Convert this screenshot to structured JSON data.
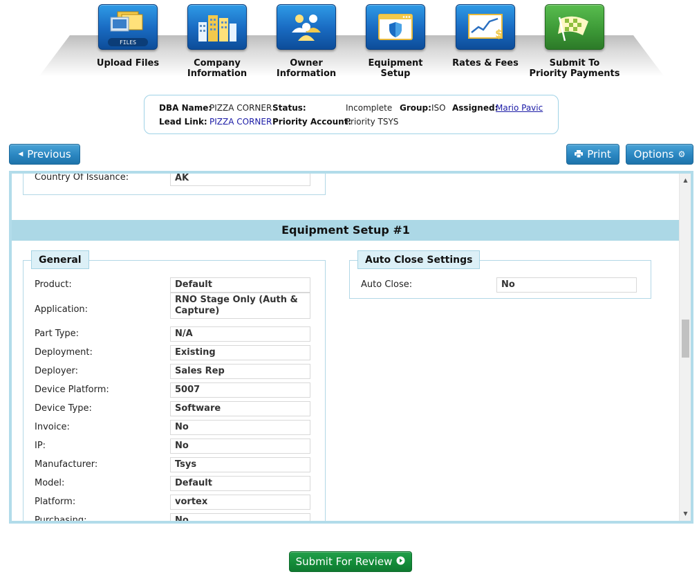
{
  "nav": {
    "steps": [
      {
        "label": "Upload Files",
        "icon": "upload-files-icon",
        "icon_text": "FILES"
      },
      {
        "label": "Company Information",
        "line1": "Company",
        "line2": "Information",
        "icon": "company-buildings-icon"
      },
      {
        "label": "Owner Information",
        "line1": "Owner",
        "line2": "Information",
        "icon": "owners-people-icon"
      },
      {
        "label": "Equipment Setup",
        "line1": "Equipment",
        "line2": "Setup",
        "icon": "equipment-window-shield-icon"
      },
      {
        "label": "Rates & Fees",
        "icon": "rates-chart-icon"
      },
      {
        "label": "Submit To Priority Payments",
        "line1": "Submit To",
        "line2": "Priority Payments",
        "icon": "checkered-flag-icon"
      }
    ]
  },
  "info": {
    "dba_label": "DBA Name:",
    "dba_value": "PIZZA CORNER",
    "status_label": "Status:",
    "status_value": "Incomplete",
    "group_label": "Group:",
    "group_value": "ISO",
    "assigned_label": "Assigned:",
    "assigned_value": "Mario Pavic",
    "lead_label": "Lead Link:",
    "lead_value": "PIZZA CORNER",
    "account_label": "Priority Account:",
    "account_value": "Priority TSYS"
  },
  "toolbar": {
    "previous_label": "Previous",
    "print_label": "Print",
    "options_label": "Options"
  },
  "prev_section": {
    "country_label": "Country Of Issuance:",
    "country_value": "AK"
  },
  "equipment": {
    "title": "Equipment Setup #1",
    "general": {
      "legend": "General",
      "fields": [
        {
          "label": "Product:",
          "value": "Default"
        },
        {
          "label": "Application:",
          "value": "RNO Stage Only (Auth & Capture)"
        },
        {
          "label": "Part Type:",
          "value": "N/A"
        },
        {
          "label": "Deployment:",
          "value": "Existing"
        },
        {
          "label": "Deployer:",
          "value": "Sales Rep"
        },
        {
          "label": "Device Platform:",
          "value": "5007"
        },
        {
          "label": "Device Type:",
          "value": "Software"
        },
        {
          "label": "Invoice:",
          "value": "No"
        },
        {
          "label": "IP:",
          "value": "No"
        },
        {
          "label": "Manufacturer:",
          "value": "Tsys"
        },
        {
          "label": "Model:",
          "value": "Default"
        },
        {
          "label": "Platform:",
          "value": "vortex"
        },
        {
          "label": "Purchasing:",
          "value": "No"
        }
      ]
    },
    "auto_close": {
      "legend": "Auto Close Settings",
      "label": "Auto Close:",
      "value": "No"
    }
  },
  "footer": {
    "submit_label": "Submit For Review"
  }
}
